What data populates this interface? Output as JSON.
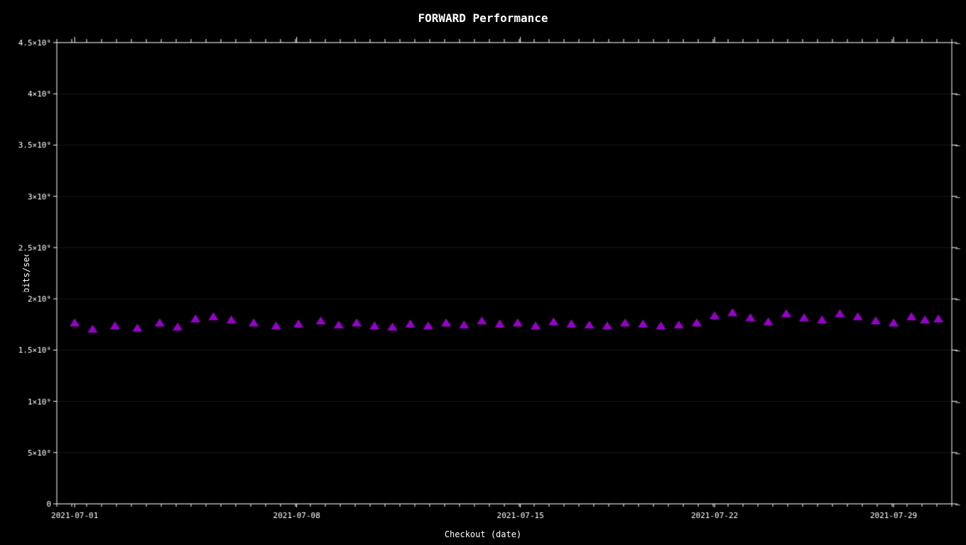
{
  "chart": {
    "title": "FORWARD Performance",
    "x_axis_label": "Checkout (date)",
    "y_axis_label": "bits/sec",
    "y_ticks": [
      {
        "label": "0",
        "value": 0
      },
      {
        "label": "5x10⁸",
        "value": 500000000
      },
      {
        "label": "1x10⁹",
        "value": 1000000000
      },
      {
        "label": "1.5x10⁹",
        "value": 1500000000
      },
      {
        "label": "2x10⁹",
        "value": 2000000000
      },
      {
        "label": "2.5x10⁹",
        "value": 2500000000
      },
      {
        "label": "3x10⁹",
        "value": 3000000000
      },
      {
        "label": "3.5x10⁹",
        "value": 3500000000
      },
      {
        "label": "4x10⁹",
        "value": 4000000000
      },
      {
        "label": "4.5x10⁹",
        "value": 4500000000
      }
    ],
    "x_ticks": [
      {
        "label": "2021-07-01",
        "position": 0.0
      },
      {
        "label": "2021-07-08",
        "position": 0.266
      },
      {
        "label": "2021-07-15",
        "position": 0.533
      },
      {
        "label": "2021-07-22",
        "position": 0.733
      },
      {
        "label": "2021-07-29",
        "position": 0.933
      }
    ],
    "y_max": 4500000000,
    "data_points": [
      {
        "x": 0.02,
        "y": 1760000000
      },
      {
        "x": 0.04,
        "y": 1700000000
      },
      {
        "x": 0.065,
        "y": 1730000000
      },
      {
        "x": 0.09,
        "y": 1710000000
      },
      {
        "x": 0.115,
        "y": 1760000000
      },
      {
        "x": 0.135,
        "y": 1720000000
      },
      {
        "x": 0.155,
        "y": 1800000000
      },
      {
        "x": 0.175,
        "y": 1820000000
      },
      {
        "x": 0.195,
        "y": 1790000000
      },
      {
        "x": 0.22,
        "y": 1760000000
      },
      {
        "x": 0.245,
        "y": 1730000000
      },
      {
        "x": 0.27,
        "y": 1750000000
      },
      {
        "x": 0.295,
        "y": 1780000000
      },
      {
        "x": 0.315,
        "y": 1740000000
      },
      {
        "x": 0.335,
        "y": 1760000000
      },
      {
        "x": 0.355,
        "y": 1730000000
      },
      {
        "x": 0.375,
        "y": 1720000000
      },
      {
        "x": 0.395,
        "y": 1750000000
      },
      {
        "x": 0.415,
        "y": 1730000000
      },
      {
        "x": 0.435,
        "y": 1760000000
      },
      {
        "x": 0.455,
        "y": 1740000000
      },
      {
        "x": 0.475,
        "y": 1780000000
      },
      {
        "x": 0.495,
        "y": 1750000000
      },
      {
        "x": 0.515,
        "y": 1760000000
      },
      {
        "x": 0.535,
        "y": 1730000000
      },
      {
        "x": 0.555,
        "y": 1770000000
      },
      {
        "x": 0.575,
        "y": 1750000000
      },
      {
        "x": 0.595,
        "y": 1740000000
      },
      {
        "x": 0.615,
        "y": 1730000000
      },
      {
        "x": 0.635,
        "y": 1760000000
      },
      {
        "x": 0.655,
        "y": 1750000000
      },
      {
        "x": 0.675,
        "y": 1730000000
      },
      {
        "x": 0.695,
        "y": 1740000000
      },
      {
        "x": 0.715,
        "y": 1760000000
      },
      {
        "x": 0.735,
        "y": 1830000000
      },
      {
        "x": 0.755,
        "y": 1860000000
      },
      {
        "x": 0.775,
        "y": 1810000000
      },
      {
        "x": 0.795,
        "y": 1770000000
      },
      {
        "x": 0.815,
        "y": 1850000000
      },
      {
        "x": 0.835,
        "y": 1810000000
      },
      {
        "x": 0.855,
        "y": 1790000000
      },
      {
        "x": 0.875,
        "y": 1850000000
      },
      {
        "x": 0.895,
        "y": 1820000000
      },
      {
        "x": 0.915,
        "y": 1780000000
      },
      {
        "x": 0.935,
        "y": 1760000000
      },
      {
        "x": 0.955,
        "y": 1820000000
      },
      {
        "x": 0.97,
        "y": 1790000000
      },
      {
        "x": 0.985,
        "y": 1800000000
      }
    ],
    "data_color": "#9900cc"
  }
}
